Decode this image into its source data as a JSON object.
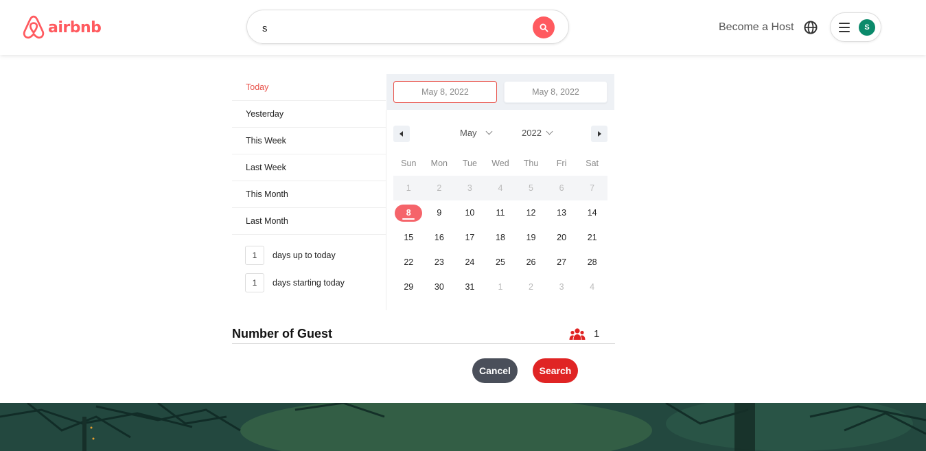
{
  "header": {
    "logo_text": "airbnb",
    "search_value": "s",
    "become_host": "Become a Host",
    "avatar_initial": "S",
    "brand_color": "#FF5A5F"
  },
  "date_picker": {
    "ranges": [
      "Today",
      "Yesterday",
      "This Week",
      "Last Week",
      "This Month",
      "Last Month"
    ],
    "active_range": "Today",
    "days_up_to_today": {
      "value": "1",
      "label": "days up to today"
    },
    "days_starting_today": {
      "value": "1",
      "label": "days starting today"
    },
    "start_date": "May 8, 2022",
    "end_date": "May 8, 2022",
    "month": "May",
    "year": "2022",
    "weekdays": [
      "Sun",
      "Mon",
      "Tue",
      "Wed",
      "Thu",
      "Fri",
      "Sat"
    ],
    "weeks": [
      [
        "1",
        "2",
        "3",
        "4",
        "5",
        "6",
        "7"
      ],
      [
        "8",
        "9",
        "10",
        "11",
        "12",
        "13",
        "14"
      ],
      [
        "15",
        "16",
        "17",
        "18",
        "19",
        "20",
        "21"
      ],
      [
        "22",
        "23",
        "24",
        "25",
        "26",
        "27",
        "28"
      ],
      [
        "29",
        "30",
        "31",
        "1",
        "2",
        "3",
        "4"
      ]
    ],
    "selected_day": "8",
    "accent_color": "#F5646A"
  },
  "guests": {
    "title": "Number of Guest",
    "count": "1"
  },
  "actions": {
    "cancel": "Cancel",
    "search": "Search"
  }
}
